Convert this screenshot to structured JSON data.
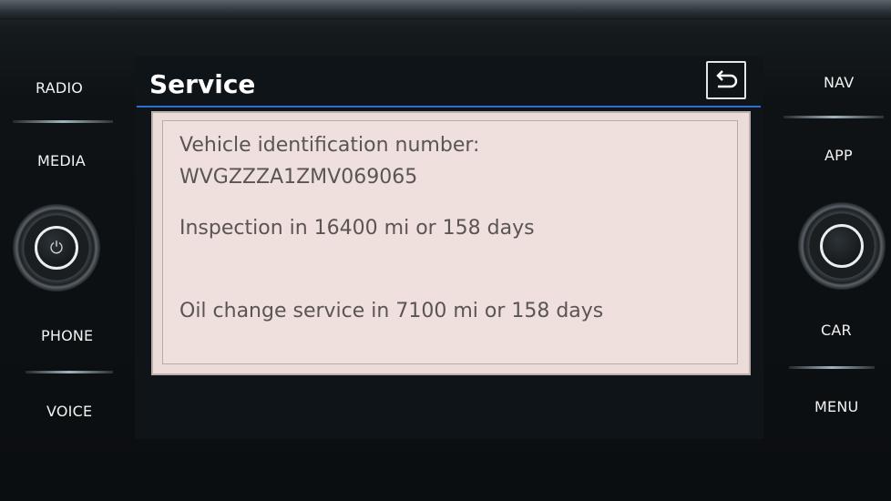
{
  "hardware_buttons": {
    "left": [
      "RADIO",
      "MEDIA",
      "PHONE",
      "VOICE"
    ],
    "right": [
      "NAV",
      "APP",
      "CAR",
      "MENU"
    ]
  },
  "screen": {
    "title": "Service",
    "accent_color": "#2f6fd0",
    "back_icon": "back-arrow-icon",
    "info": {
      "vin_label": "Vehicle identification number:",
      "vin_value": "WVGZZZA1ZMV069065",
      "inspection": "Inspection in 16400 mi or 158 days",
      "oil_change": "Oil change service in 7100 mi or 158 days"
    }
  }
}
